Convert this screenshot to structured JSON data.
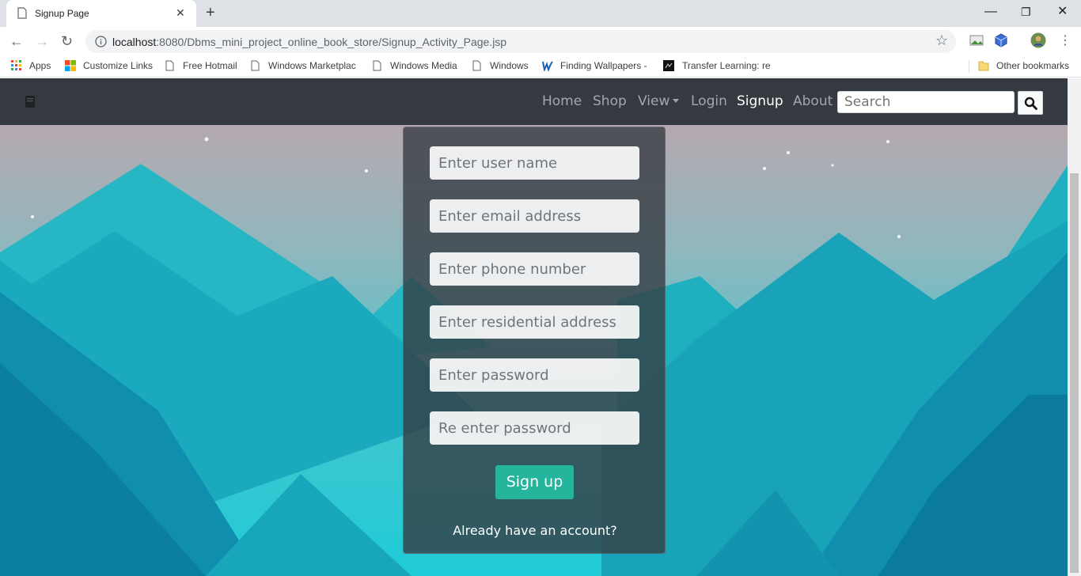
{
  "browser": {
    "tab_title": "Signup Page",
    "new_tab": "+",
    "url_host": "localhost",
    "url_rest": ":8080/Dbms_mini_project_online_book_store/Signup_Activity_Page.jsp",
    "window_controls": {
      "minimize": "—",
      "restore": "❐",
      "close": "✕"
    },
    "bookmarks": [
      {
        "label": "Apps",
        "icon": "apps-grid-icon"
      },
      {
        "label": "Customize Links",
        "icon": "windows-logo-icon"
      },
      {
        "label": "Free Hotmail",
        "icon": "page-icon"
      },
      {
        "label": "Windows Marketplac",
        "icon": "page-icon"
      },
      {
        "label": "Windows Media",
        "icon": "page-icon"
      },
      {
        "label": "Windows",
        "icon": "page-icon"
      },
      {
        "label": "Finding Wallpapers -",
        "icon": "site-icon"
      },
      {
        "label": "Transfer Learning: ret",
        "icon": "site-icon"
      }
    ],
    "other_bookmarks": "Other bookmarks"
  },
  "navbar": {
    "links": [
      "Home",
      "Shop",
      "View",
      "Login",
      "Signup",
      "About"
    ],
    "active": "Signup",
    "search_placeholder": "Search"
  },
  "form": {
    "username_placeholder": "Enter user name",
    "email_placeholder": "Enter email address",
    "phone_placeholder": "Enter phone number",
    "address_placeholder": "Enter residential address",
    "password_placeholder": "Enter password",
    "repassword_placeholder": "Re enter password",
    "submit_label": "Sign up",
    "login_prompt": "Already have an account?"
  },
  "colors": {
    "navbar": "#343a40",
    "accent": "#25b59d",
    "sky_top": "#c4a3aa",
    "mountain": "#1aa9bd"
  }
}
